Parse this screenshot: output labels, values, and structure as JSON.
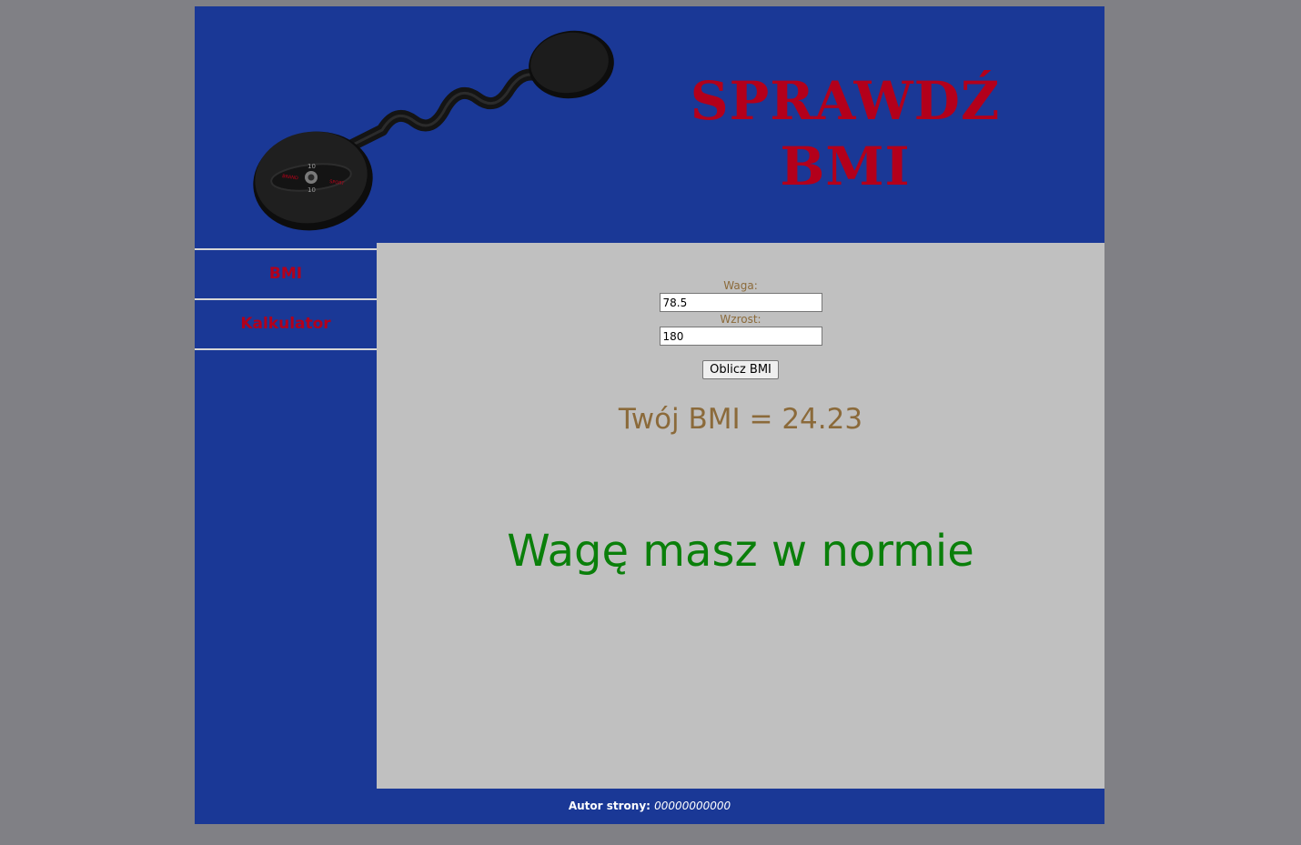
{
  "banner": {
    "title_line1": "SPRAWDŹ",
    "title_line2": "BMI",
    "image_icon": "barbell-icon"
  },
  "sidebar": {
    "items": [
      {
        "label": "BMI"
      },
      {
        "label": "Kalkulator"
      }
    ]
  },
  "form": {
    "weight_label": "Waga:",
    "weight_value": "78.5",
    "height_label": "Wzrost:",
    "height_value": "180",
    "submit_label": "Oblicz BMI"
  },
  "result": {
    "text": "Twój BMI = 24.23",
    "verdict": "Wagę masz w normie"
  },
  "footer": {
    "label": "Autor strony:",
    "value": "00000000000"
  },
  "colors": {
    "page_background": "#808085",
    "banner_blue": "#1a3896",
    "title_red": "#b3001b",
    "content_gray": "#c0c0c0",
    "label_brown": "#8b6a3a",
    "verdict_green": "#0a7f0a"
  }
}
